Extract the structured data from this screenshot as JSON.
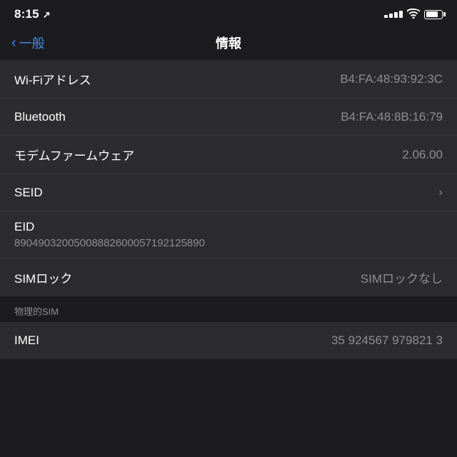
{
  "statusBar": {
    "time": "8:15",
    "arrow": "↗"
  },
  "navBar": {
    "backLabel": "一般",
    "title": "情報"
  },
  "rows": [
    {
      "id": "wifi-address",
      "label": "Wi-Fiアドレス",
      "value": "B4:FA:48:93:92:3C",
      "type": "value"
    },
    {
      "id": "bluetooth",
      "label": "Bluetooth",
      "value": "B4:FA:48:8B:16:79",
      "type": "value"
    },
    {
      "id": "modem-firmware",
      "label": "モデムファームウェア",
      "value": "2.06.00",
      "type": "value"
    },
    {
      "id": "seid",
      "label": "SEID",
      "value": "",
      "type": "chevron"
    },
    {
      "id": "eid",
      "label": "EID",
      "value": "89049032005008882600057192125890",
      "type": "multiline"
    },
    {
      "id": "sim-lock",
      "label": "SIMロック",
      "value": "SIMロックなし",
      "type": "value"
    }
  ],
  "physicalSim": {
    "sectionLabel": "物理的SIM"
  },
  "imeiRow": {
    "label": "IMEI",
    "value": "35 924567 979821 3"
  }
}
